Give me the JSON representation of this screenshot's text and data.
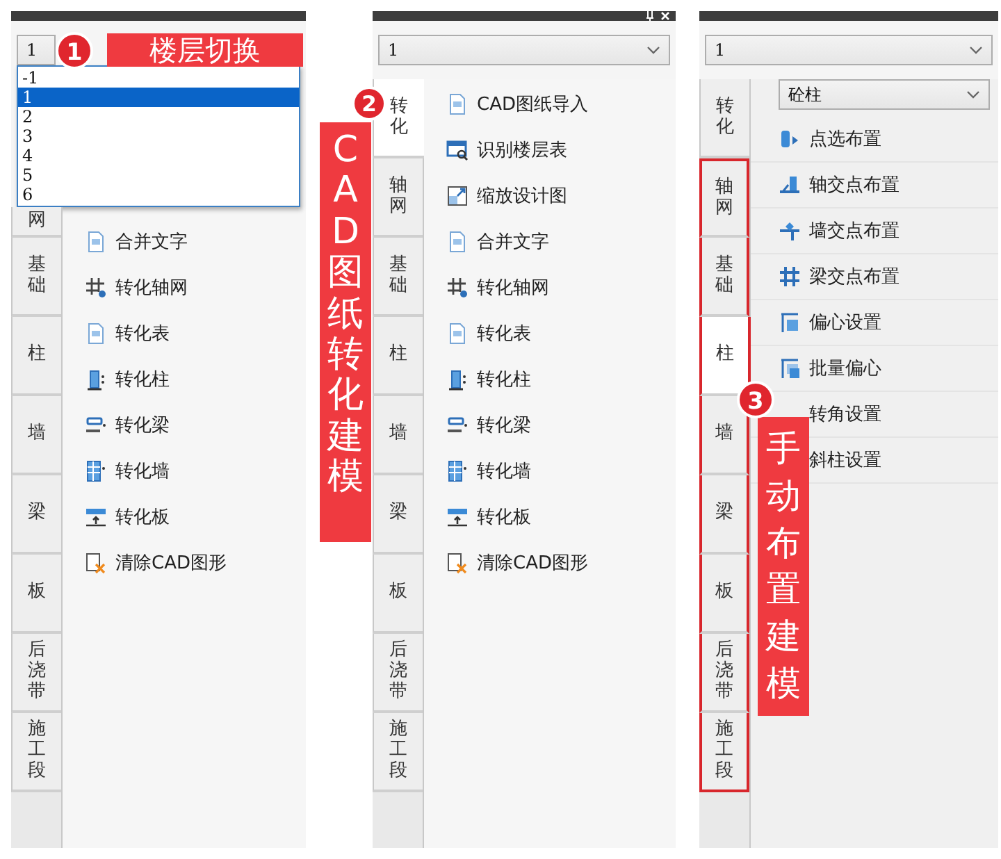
{
  "panels": [
    {
      "floor_select": {
        "value": "1",
        "open": true,
        "options": [
          {
            "label": "-1",
            "selected": false
          },
          {
            "label": "1",
            "selected": true
          },
          {
            "label": "2",
            "selected": false
          },
          {
            "label": "3",
            "selected": false
          },
          {
            "label": "4",
            "selected": false
          },
          {
            "label": "5",
            "selected": false
          },
          {
            "label": "6",
            "selected": false
          }
        ]
      },
      "tabs": [
        {
          "label": "网",
          "selected": false,
          "highlighted": false
        },
        {
          "label": "基础",
          "selected": false,
          "highlighted": false
        },
        {
          "label": "柱",
          "selected": false,
          "highlighted": false
        },
        {
          "label": "墙",
          "selected": false,
          "highlighted": false
        },
        {
          "label": "梁",
          "selected": false,
          "highlighted": false
        },
        {
          "label": "板",
          "selected": false,
          "highlighted": false
        },
        {
          "label": "后浇带",
          "selected": false,
          "highlighted": false
        },
        {
          "label": "施工段",
          "selected": false,
          "highlighted": false
        }
      ],
      "items": [
        {
          "label": "合并文字"
        },
        {
          "label": "转化轴网"
        },
        {
          "label": "转化表"
        },
        {
          "label": "转化柱"
        },
        {
          "label": "转化梁"
        },
        {
          "label": "转化墙"
        },
        {
          "label": "转化板"
        },
        {
          "label": "清除CAD图形"
        }
      ]
    },
    {
      "floor_select": {
        "value": "1",
        "open": false
      },
      "tabs": [
        {
          "label": "转化",
          "selected": true,
          "highlighted": false
        },
        {
          "label": "轴网",
          "selected": false,
          "highlighted": false
        },
        {
          "label": "基础",
          "selected": false,
          "highlighted": false
        },
        {
          "label": "柱",
          "selected": false,
          "highlighted": false
        },
        {
          "label": "墙",
          "selected": false,
          "highlighted": false
        },
        {
          "label": "梁",
          "selected": false,
          "highlighted": false
        },
        {
          "label": "板",
          "selected": false,
          "highlighted": false
        },
        {
          "label": "后浇带",
          "selected": false,
          "highlighted": false
        },
        {
          "label": "施工段",
          "selected": false,
          "highlighted": false
        }
      ],
      "items": [
        {
          "label": "CAD图纸导入"
        },
        {
          "label": "识别楼层表"
        },
        {
          "label": "缩放设计图"
        },
        {
          "label": "合并文字"
        },
        {
          "label": "转化轴网"
        },
        {
          "label": "转化表"
        },
        {
          "label": "转化柱"
        },
        {
          "label": "转化梁"
        },
        {
          "label": "转化墙"
        },
        {
          "label": "转化板"
        },
        {
          "label": "清除CAD图形"
        }
      ]
    },
    {
      "floor_select": {
        "value": "1",
        "open": false
      },
      "type_select": {
        "value": "砼柱"
      },
      "tabs": [
        {
          "label": "转化",
          "selected": false,
          "highlighted": false
        },
        {
          "label": "轴网",
          "selected": false,
          "highlighted": true
        },
        {
          "label": "基础",
          "selected": false,
          "highlighted": true
        },
        {
          "label": "柱",
          "selected": true,
          "highlighted": true
        },
        {
          "label": "墙",
          "selected": false,
          "highlighted": true
        },
        {
          "label": "梁",
          "selected": false,
          "highlighted": true
        },
        {
          "label": "板",
          "selected": false,
          "highlighted": true
        },
        {
          "label": "后浇带",
          "selected": false,
          "highlighted": true
        },
        {
          "label": "施工段",
          "selected": false,
          "highlighted": true
        }
      ],
      "items": [
        {
          "label": "点选布置"
        },
        {
          "label": "轴交点布置"
        },
        {
          "label": "墙交点布置"
        },
        {
          "label": "梁交点布置"
        },
        {
          "label": "偏心设置"
        },
        {
          "label": "批量偏心"
        },
        {
          "label": "转角设置"
        },
        {
          "label": "斜柱设置"
        }
      ]
    }
  ],
  "callouts": [
    {
      "number": "1",
      "text": "楼层切换",
      "kind": "horizontal"
    },
    {
      "number": "2",
      "text": "CAD图纸转化建模",
      "kind": "vertical"
    },
    {
      "number": "3",
      "text": "手动布置建模",
      "kind": "vertical"
    }
  ]
}
